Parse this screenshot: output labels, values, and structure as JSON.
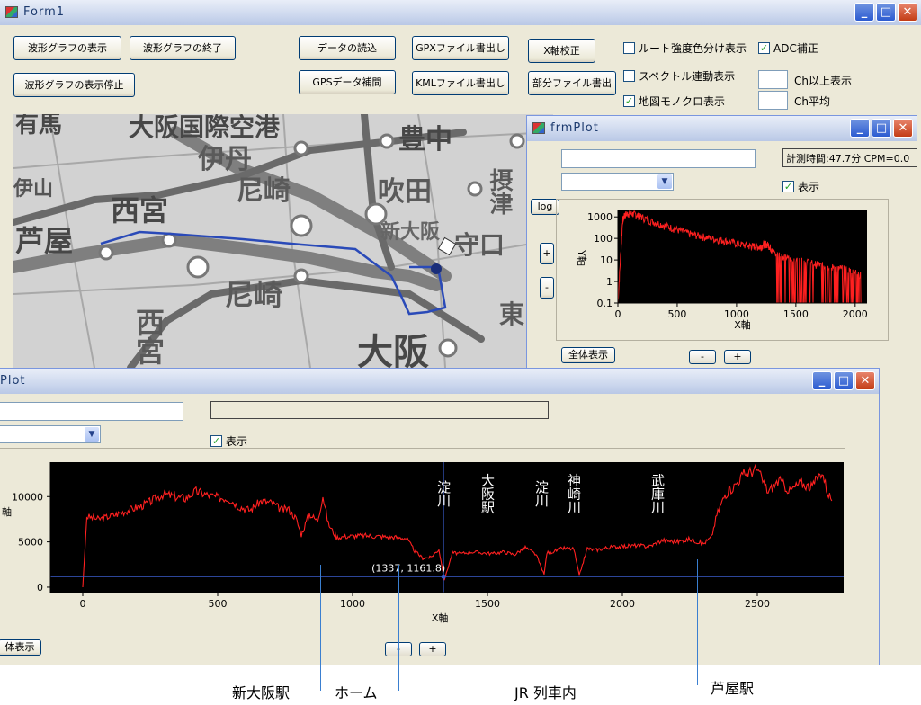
{
  "form1": {
    "title": "Form1",
    "buttons": {
      "show_waveform": "波形グラフの表示",
      "end_waveform": "波形グラフの終了",
      "stop_waveform": "波形グラフの表示停止",
      "read_data": "データの読込",
      "gps_interp": "GPSデータ補間",
      "gpx_write": "GPXファイル書出し",
      "kml_write": "KMLファイル書出し",
      "x_calib": "X軸校正",
      "partial_write": "部分ファイル書出"
    },
    "checkboxes": {
      "route_color": {
        "label": "ルート強度色分け表示",
        "checked": false
      },
      "adc": {
        "label": "ADC補正",
        "checked": true
      },
      "spectrum_link": {
        "label": "スペクトル連動表示",
        "checked": false
      },
      "map_mono": {
        "label": "地図モノクロ表示",
        "checked": true
      }
    },
    "ch_above_label": "Ch以上表示",
    "ch_avg_label": "Ch平均",
    "map_labels": [
      "有馬",
      "大阪国際空港",
      "伊丹",
      "豊中",
      "尼崎",
      "吹田",
      "西宮",
      "芦屋",
      "新大阪",
      "守口",
      "尼崎",
      "西宮",
      "大阪",
      "東",
      "摂津",
      "伊山"
    ]
  },
  "frmplot_small": {
    "title": "frmPlot",
    "status": "計測時間:47.7分  CPM=0.0",
    "log_button": "log",
    "plus_button": "+",
    "minus_button": "-",
    "show_label": "表示",
    "show_checked": true,
    "show_all_button": "全体表示",
    "bottom_minus": "-",
    "bottom_plus": "+",
    "chart_data": {
      "type": "line",
      "scale": "log",
      "xlabel": "X軸",
      "ylabel": "Y軸",
      "xlim": [
        0,
        2100
      ],
      "ylim": [
        0.1,
        2000
      ],
      "x_ticks": [
        0,
        500,
        1000,
        1500,
        2000
      ],
      "y_ticks": [
        0.1,
        1,
        10,
        100,
        1000
      ],
      "y_tick_labels": [
        "0.1",
        "1",
        "10",
        "100",
        "1000"
      ],
      "series": [
        {
          "x": [
            0,
            40,
            60,
            100,
            150,
            200,
            300,
            400,
            500,
            600,
            700,
            800,
            900,
            1000,
            1100,
            1150,
            1200,
            1240,
            1280,
            1300,
            1400,
            1500,
            1600,
            1700,
            1800,
            1900,
            2000,
            2050
          ],
          "values": [
            0.1,
            700,
            1300,
            1500,
            1300,
            1000,
            600,
            400,
            260,
            170,
            130,
            100,
            80,
            60,
            45,
            45,
            40,
            60,
            45,
            25,
            15,
            10,
            8,
            6,
            5,
            4,
            3,
            2
          ]
        }
      ]
    }
  },
  "frmplot_large": {
    "title": "Plot",
    "show_label": "表示",
    "show_checked": true,
    "show_all_button": "体表示",
    "bottom_minus": "-",
    "bottom_plus": "+",
    "chart_data": {
      "type": "line",
      "xlabel": "X軸",
      "ylabel": "軸",
      "xlim": [
        -120,
        2820
      ],
      "ylim": [
        -600,
        13800
      ],
      "x_ticks": [
        0,
        500,
        1000,
        1500,
        2000,
        2500
      ],
      "y_ticks": [
        0,
        5000,
        10000
      ],
      "cursor": {
        "x": 1337,
        "y": 1161.8,
        "label": "(1337, 1161.8)"
      },
      "annotations": [
        "淀川",
        "大阪駅",
        "淀川",
        "神崎川",
        "武庫川"
      ],
      "series": [
        {
          "x": [
            0,
            15,
            60,
            120,
            180,
            220,
            260,
            300,
            340,
            380,
            420,
            460,
            500,
            540,
            580,
            620,
            660,
            700,
            740,
            760,
            790,
            810,
            840,
            870,
            890,
            910,
            940,
            980,
            1040,
            1100,
            1160,
            1200,
            1230,
            1260,
            1290,
            1320,
            1340,
            1370,
            1400,
            1440,
            1480,
            1520,
            1560,
            1600,
            1640,
            1680,
            1710,
            1720,
            1740,
            1780,
            1820,
            1840,
            1870,
            1880,
            1900,
            1950,
            2000,
            2050,
            2100,
            2150,
            2200,
            2250,
            2300,
            2330,
            2350,
            2380,
            2410,
            2450,
            2500,
            2540,
            2580,
            2620,
            2660,
            2700,
            2740,
            2760,
            2780
          ],
          "values": [
            0,
            7800,
            7500,
            8000,
            8600,
            9000,
            9600,
            10300,
            10000,
            9800,
            10600,
            10200,
            9900,
            9800,
            8900,
            8500,
            9500,
            9300,
            8500,
            8700,
            7600,
            5800,
            8100,
            7300,
            10100,
            7000,
            5500,
            5600,
            5700,
            5600,
            5500,
            5400,
            4000,
            3200,
            3300,
            4200,
            800,
            3800,
            3700,
            3900,
            3800,
            3700,
            3900,
            3600,
            4400,
            3600,
            1400,
            3800,
            3900,
            4300,
            4200,
            1300,
            4300,
            4200,
            4100,
            4400,
            4500,
            4600,
            4500,
            5200,
            5000,
            5300,
            4800,
            5500,
            8000,
            10200,
            11000,
            12500,
            13000,
            10500,
            11800,
            10600,
            11500,
            11000,
            12800,
            10500,
            9500
          ]
        }
      ]
    }
  },
  "captions": {
    "shin_osaka": "新大阪駅",
    "home": "ホーム",
    "jr_train": "JR 列車内",
    "ashiya": "芦屋駅"
  }
}
